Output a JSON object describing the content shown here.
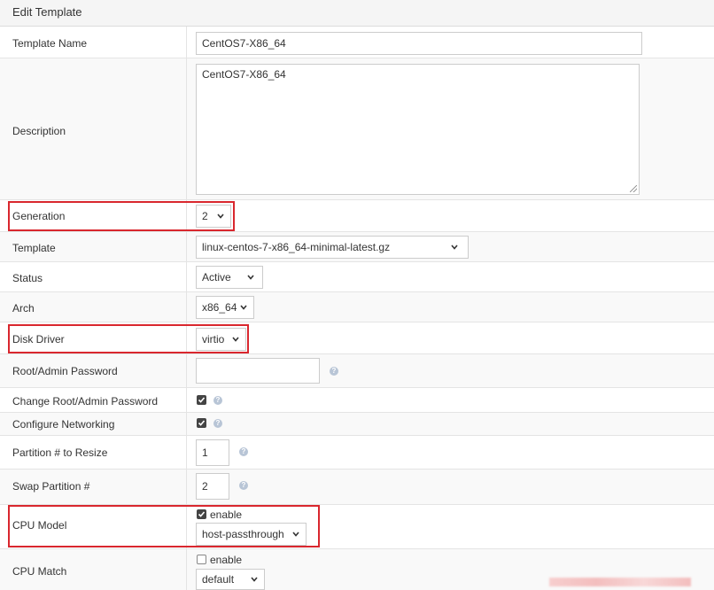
{
  "header": {
    "title": "Edit Template"
  },
  "fields": {
    "template_name": {
      "label": "Template Name",
      "value": "CentOS7-X86_64"
    },
    "description": {
      "label": "Description",
      "value": "CentOS7-X86_64"
    },
    "generation": {
      "label": "Generation",
      "value": "2"
    },
    "template": {
      "label": "Template",
      "value": "linux-centos-7-x86_64-minimal-latest.gz"
    },
    "status": {
      "label": "Status",
      "value": "Active"
    },
    "arch": {
      "label": "Arch",
      "value": "x86_64"
    },
    "disk_driver": {
      "label": "Disk Driver",
      "value": "virtio"
    },
    "root_password": {
      "label": "Root/Admin Password",
      "value": ""
    },
    "change_root_password": {
      "label": "Change Root/Admin Password",
      "checked": true
    },
    "configure_networking": {
      "label": "Configure Networking",
      "checked": true
    },
    "partition_resize": {
      "label": "Partition # to Resize",
      "value": "1"
    },
    "swap_partition": {
      "label": "Swap Partition #",
      "value": "2"
    },
    "cpu_model": {
      "label": "CPU Model",
      "enable_label": "enable",
      "enabled": true,
      "value": "host-passthrough"
    },
    "cpu_match": {
      "label": "CPU Match",
      "enable_label": "enable",
      "enabled": false,
      "value": "default"
    }
  },
  "help_icon": "question-circle-icon",
  "colors": {
    "highlight": "#d9272e",
    "header_bg": "#f5f5f5",
    "border": "#cccccc"
  }
}
